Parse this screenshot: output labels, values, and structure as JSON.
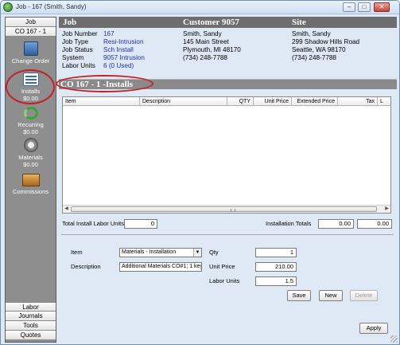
{
  "window": {
    "title": "Job - 167 (Smith, Sandy)",
    "minimize_glyph": "–",
    "maximize_glyph": "□",
    "close_glyph": "✕"
  },
  "sidebar": {
    "top_tabs": [
      "Job",
      "CO 167 - 1"
    ],
    "items": [
      {
        "label": "Change Order",
        "icon": "change-order-icon"
      },
      {
        "label": "Installs",
        "amount": "$0.00",
        "icon": "installs-icon"
      },
      {
        "label": "Recurring",
        "amount": "$0.00",
        "icon": "recurring-icon"
      },
      {
        "label": "Materials",
        "amount": "$0.00",
        "icon": "materials-icon"
      },
      {
        "label": "Commissions",
        "icon": "commissions-icon"
      }
    ],
    "bottom_tabs": [
      "Labor",
      "Journals",
      "Tools",
      "Quotes"
    ]
  },
  "header": {
    "job": "Job",
    "customer": "Customer 9057",
    "site": "Site"
  },
  "job_info": {
    "labels": [
      "Job Number",
      "Job Type",
      "Job Status",
      "System",
      "Labor Units"
    ],
    "values": [
      "167",
      "Resi-Intrusion",
      "Sch Install",
      "9057 Intrusion",
      "6 (0 Used)"
    ]
  },
  "customer": [
    "Smith, Sandy",
    "145 Main Street",
    "Plymouth, MI  48170",
    "(734) 248-7788"
  ],
  "site": [
    "Smith, Sandy",
    "299 Shadow Hills Road",
    "Seattle, WA  98170",
    "(734) 248-7788"
  ],
  "section_title": "CO 167 - 1 -Installs",
  "grid": {
    "columns": [
      "Item",
      "Description",
      "QTY",
      "Unit Price",
      "Extended Price",
      "Tax",
      "L"
    ],
    "rows": []
  },
  "totals": {
    "labor_units_label": "Total Install Labor Units",
    "labor_units_value": "0",
    "installation_totals_label": "Installation Totals",
    "total_1": "0.00",
    "total_2": "0.00"
  },
  "detail": {
    "item_label": "Item",
    "item_value": "Materials - Installation",
    "description_label": "Description",
    "description_value": "Additional Materials CO#1; 1 key",
    "qty_label": "Qty",
    "qty_value": "1",
    "unit_price_label": "Unit Price",
    "unit_price_value": "210.00",
    "labor_units_label": "Labor Units",
    "labor_units_value": "1.5",
    "save": "Save",
    "new": "New",
    "delete": "Delete"
  },
  "apply": "Apply"
}
